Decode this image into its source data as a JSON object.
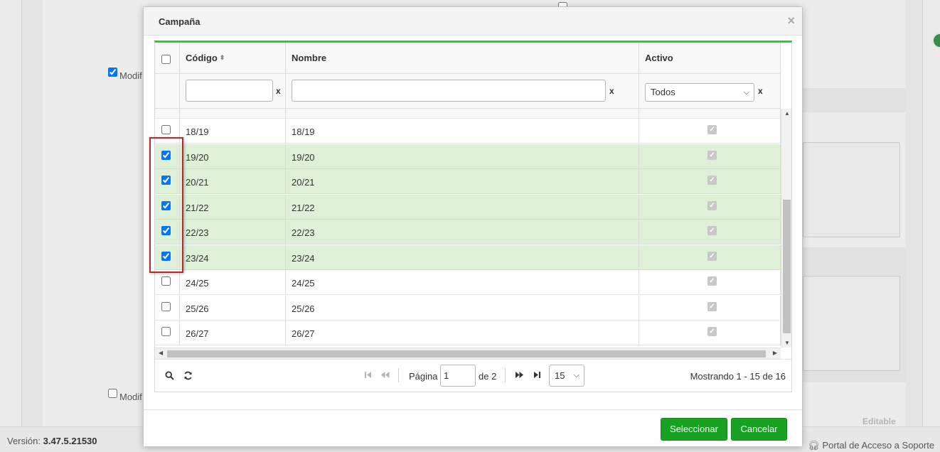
{
  "background": {
    "checkbox_label_top": "Modif",
    "checkbox_label_bottom": "Modif",
    "editable_label": "Editable"
  },
  "footer": {
    "version_label": "Versión:",
    "version_value": "3.47.5.21530",
    "support_link": "Portal de Acceso a Soporte"
  },
  "modal": {
    "title": "Campaña",
    "close_glyph": "×"
  },
  "grid": {
    "columns": [
      "Código",
      "Nombre",
      "Activo"
    ],
    "sort_glyph": "⬍",
    "filter_clear": "x",
    "activo_filter_value": "Todos",
    "rows": [
      {
        "codigo": "18/19",
        "nombre": "18/19",
        "selected": false
      },
      {
        "codigo": "19/20",
        "nombre": "19/20",
        "selected": true
      },
      {
        "codigo": "20/21",
        "nombre": "20/21",
        "selected": true
      },
      {
        "codigo": "21/22",
        "nombre": "21/22",
        "selected": true
      },
      {
        "codigo": "22/23",
        "nombre": "22/23",
        "selected": true
      },
      {
        "codigo": "23/24",
        "nombre": "23/24",
        "selected": true
      },
      {
        "codigo": "24/25",
        "nombre": "24/25",
        "selected": false
      },
      {
        "codigo": "25/26",
        "nombre": "25/26",
        "selected": false
      },
      {
        "codigo": "26/27",
        "nombre": "26/27",
        "selected": false
      }
    ]
  },
  "pager": {
    "page_label": "Página",
    "page_value": "1",
    "of_label": "de 2",
    "page_size": "15",
    "info": "Mostrando 1 - 15 de 16"
  },
  "buttons": {
    "select": "Seleccionar",
    "cancel": "Cancelar"
  },
  "colors": {
    "accent_green": "#17a321",
    "grid_top_border": "#2ecc2e",
    "selected_row": "#dff0d8",
    "annotation_red": "#b32a2a"
  }
}
